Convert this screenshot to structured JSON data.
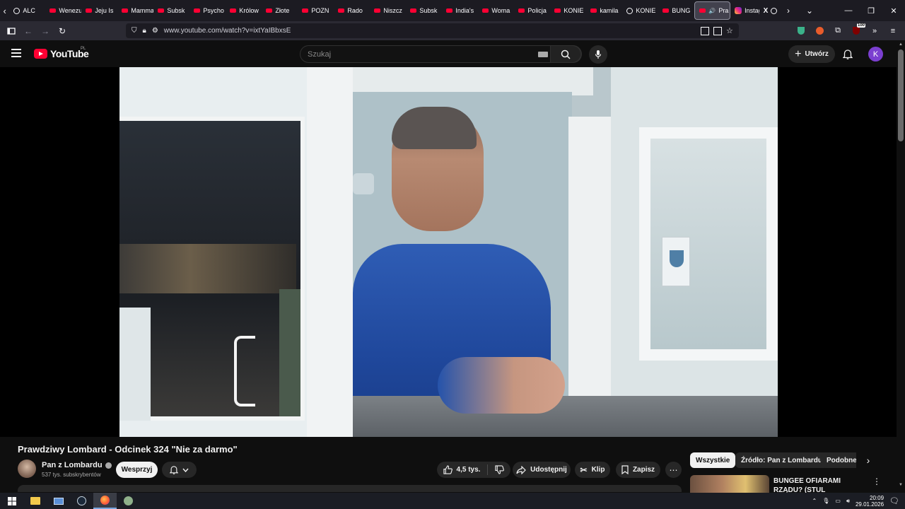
{
  "browser": {
    "tabs": [
      {
        "label": "ALC",
        "icon": "generic-icon"
      },
      {
        "label": "Wenezuela",
        "icon": "youtube-icon"
      },
      {
        "label": "Jeju Is",
        "icon": "youtube-icon"
      },
      {
        "label": "Mamma",
        "icon": "youtube-icon"
      },
      {
        "label": "Subsk",
        "icon": "youtube-icon"
      },
      {
        "label": "Psycho",
        "icon": "youtube-icon"
      },
      {
        "label": "Królow",
        "icon": "youtube-icon"
      },
      {
        "label": "Złote",
        "icon": "youtube-icon"
      },
      {
        "label": "POZN",
        "icon": "youtube-icon"
      },
      {
        "label": "Rado",
        "icon": "youtube-icon"
      },
      {
        "label": "Niszcz",
        "icon": "youtube-icon"
      },
      {
        "label": "Subsk",
        "icon": "youtube-icon"
      },
      {
        "label": "India's",
        "icon": "youtube-icon"
      },
      {
        "label": "Woma",
        "icon": "youtube-icon"
      },
      {
        "label": "Policja",
        "icon": "youtube-icon"
      },
      {
        "label": "KONIE",
        "icon": "youtube-icon"
      },
      {
        "label": "kamila",
        "icon": "youtube-icon"
      },
      {
        "label": "KONIE",
        "icon": "generic-icon"
      },
      {
        "label": "BUNG",
        "icon": "youtube-icon"
      }
    ],
    "active_tab": {
      "label": "Pra",
      "icon": "youtube-icon"
    },
    "extra_tabs": [
      {
        "label": "Instag",
        "icon": "instagram-icon"
      },
      {
        "label": "X",
        "icon": "x-icon"
      }
    ],
    "url": "www.youtube.com/watch?v=ixtYaIBbxsE",
    "extension_badge": "100"
  },
  "youtube": {
    "logo_text": "YouTube",
    "country_code": "PL",
    "search_placeholder": "Szukaj",
    "create_label": "Utwórz",
    "avatar_letter": "K"
  },
  "video": {
    "title": "Prawdziwy Lombard - Odcinek 324 \"Nie za darmo\"",
    "channel": "Pan z Lombardu",
    "subscribers": "537 tys. subskrybentów",
    "support_label": "Wesprzyj",
    "likes": "4,5 tys.",
    "share_label": "Udostępnij",
    "clip_label": "Klip",
    "save_label": "Zapisz"
  },
  "sidebar": {
    "chips": [
      "Wszystkie",
      "Źródło: Pan z Lombardu",
      "Podobne"
    ],
    "recommendation_title": "BUNGEE OFIARAMI RZĄDU? (STUL DZINOLD BANDURA"
  },
  "taskbar": {
    "time": "20:09",
    "date": "29.01.2026"
  }
}
